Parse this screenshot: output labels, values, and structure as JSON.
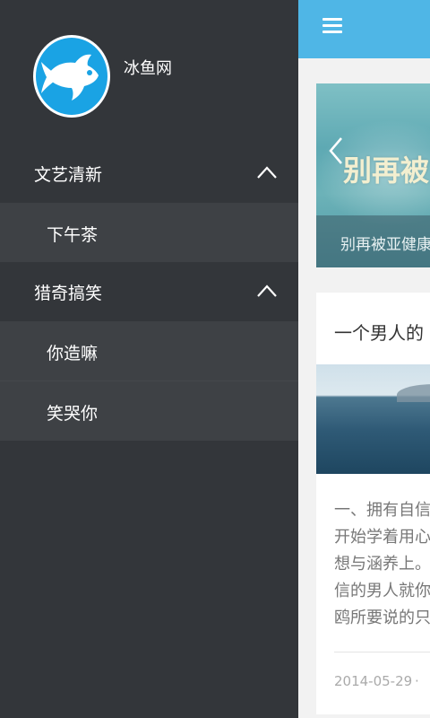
{
  "drawer": {
    "site_name": "冰鱼网",
    "groups": [
      {
        "label": "文艺清新",
        "expanded": true,
        "items": [
          {
            "label": "下午茶"
          }
        ]
      },
      {
        "label": "猎奇搞笑",
        "expanded": true,
        "items": [
          {
            "label": "你造嘛"
          },
          {
            "label": "笑哭你"
          }
        ]
      }
    ]
  },
  "main": {
    "banner": {
      "headline": "别再被",
      "caption": "别再被亚健康"
    },
    "card": {
      "title": "一个男人的",
      "excerpt_lines": [
        "一、拥有自信",
        "开始学着用心",
        "想与涵养上。",
        "信的男人就你",
        "鸥所要说的只"
      ],
      "date": "2014-05-29",
      "separator": "·"
    }
  },
  "colors": {
    "accent": "#4fb6e6",
    "drawer_bg": "#33363a",
    "drawer_sub_bg": "#3e4145",
    "avatar_bg": "#1aa3e4"
  },
  "icons": [
    "menu-icon",
    "chevron-left-icon",
    "fish-logo-icon",
    "chevron-up-icon"
  ]
}
